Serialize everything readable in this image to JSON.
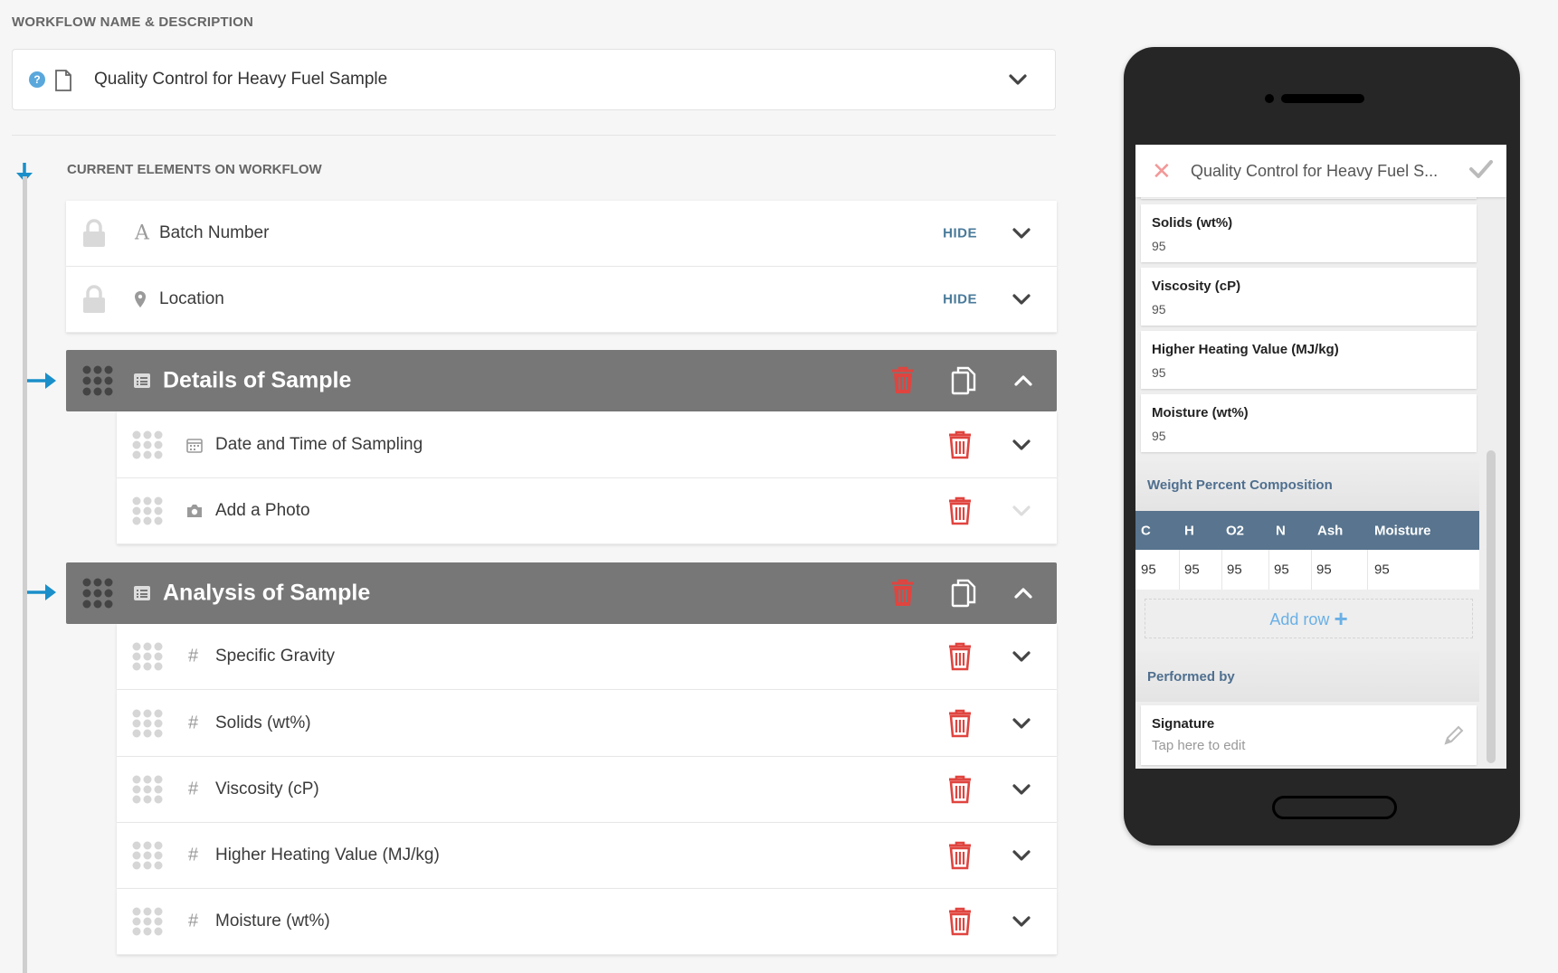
{
  "workflow": {
    "section_label": "WORKFLOW NAME & DESCRIPTION",
    "name": "Quality Control for Heavy Fuel Sample",
    "current_label": "CURRENT ELEMENTS ON WORKFLOW"
  },
  "locked_fields": [
    {
      "label": "Batch Number",
      "icon": "text-icon",
      "action": "HIDE"
    },
    {
      "label": "Location",
      "icon": "location-pin-icon",
      "action": "HIDE"
    }
  ],
  "sections": [
    {
      "title": "Details of Sample",
      "items": [
        {
          "label": "Date and Time of Sampling",
          "icon": "calendar-icon"
        },
        {
          "label": "Add a Photo",
          "icon": "camera-icon"
        }
      ]
    },
    {
      "title": "Analysis of Sample",
      "items": [
        {
          "label": "Specific Gravity",
          "icon": "hash-icon"
        },
        {
          "label": "Solids (wt%)",
          "icon": "hash-icon"
        },
        {
          "label": "Viscosity (cP)",
          "icon": "hash-icon"
        },
        {
          "label": "Higher Heating Value (MJ/kg)",
          "icon": "hash-icon"
        },
        {
          "label": "Moisture (wt%)",
          "icon": "hash-icon"
        }
      ]
    }
  ],
  "preview": {
    "title": "Quality Control for Heavy Fuel S...",
    "cards": [
      {
        "label": "Solids (wt%)",
        "value": "95"
      },
      {
        "label": "Viscosity (cP)",
        "value": "95"
      },
      {
        "label": "Higher Heating Value (MJ/kg)",
        "value": "95"
      },
      {
        "label": "Moisture (wt%)",
        "value": "95"
      }
    ],
    "table_title": "Weight Percent Composition",
    "table_columns": [
      "C",
      "H",
      "O2",
      "N",
      "Ash",
      "Moisture"
    ],
    "table_row": [
      "95",
      "95",
      "95",
      "95",
      "95",
      "95"
    ],
    "add_row": "Add row",
    "performed_by": "Performed by",
    "signature_label": "Signature",
    "signature_hint": "Tap here to edit"
  },
  "colors": {
    "accent_blue": "#1a8fc9",
    "delete_red": "#e0443f",
    "section_gray": "#777777",
    "hide_text": "#4a7a9a",
    "table_header": "#58748e"
  }
}
